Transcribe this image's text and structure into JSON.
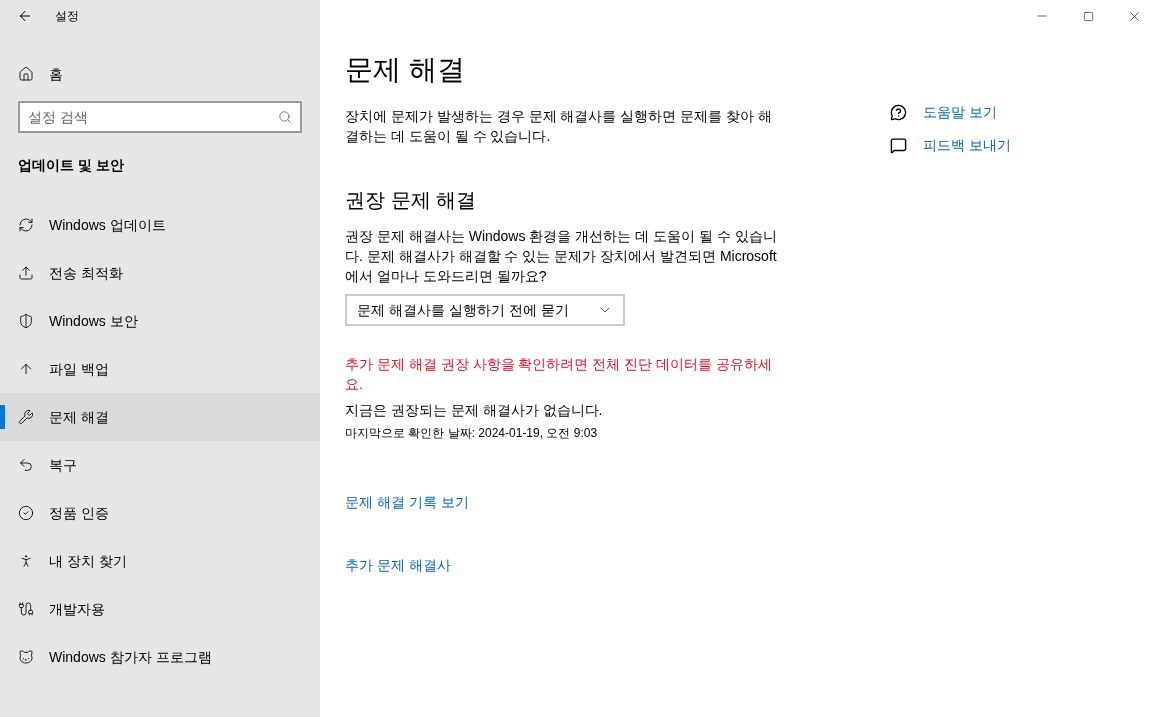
{
  "window": {
    "title": "설정"
  },
  "sidebar": {
    "home": "홈",
    "search": {
      "placeholder": "설정 검색"
    },
    "section": "업데이트 및 보안",
    "items": [
      {
        "label": "Windows 업데이트",
        "selected": false
      },
      {
        "label": "전송 최적화",
        "selected": false
      },
      {
        "label": "Windows 보안",
        "selected": false
      },
      {
        "label": "파일 백업",
        "selected": false
      },
      {
        "label": "문제 해결",
        "selected": true
      },
      {
        "label": "복구",
        "selected": false
      },
      {
        "label": "정품 인증",
        "selected": false
      },
      {
        "label": "내 장치 찾기",
        "selected": false
      },
      {
        "label": "개발자용",
        "selected": false
      },
      {
        "label": "Windows 참가자 프로그램",
        "selected": false
      }
    ]
  },
  "main": {
    "title": "문제 해결",
    "intro": "장치에 문제가 발생하는 경우 문제 해결사를 실행하면 문제를 찾아 해결하는 데 도움이 될 수 있습니다.",
    "section_title": "권장 문제 해결",
    "section_text": "권장 문제 해결사는 Windows 환경을 개선하는 데 도움이 될 수 있습니다. 문제 해결사가 해결할 수 있는 문제가 장치에서 발견되면 Microsoft에서 얼마나 도와드리면 될까요?",
    "dropdown": {
      "value": "문제 해결사를 실행하기 전에 묻기"
    },
    "warning": "추가 문제 해결 권장 사항을 확인하려면 전체 진단 데이터를 공유하세요.",
    "status": "지금은 권장되는 문제 해결사가 없습니다.",
    "last_checked": "마지막으로 확인한 날짜: 2024-01-19, 오전 9:03",
    "links": [
      "문제 해결 기록 보기",
      "추가 문제 해결사"
    ]
  },
  "help_links": [
    "도움말 보기",
    "피드백 보내기"
  ]
}
